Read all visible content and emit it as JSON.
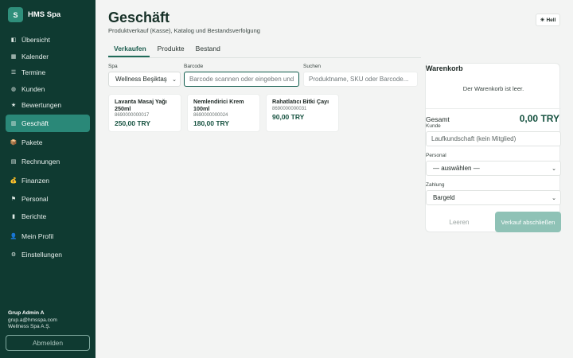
{
  "brand": {
    "logo_letter": "S",
    "name": "HMS Spa"
  },
  "sidebar": {
    "items": [
      {
        "label": "Übersicht",
        "icon": "◧",
        "icon_name": "overview-icon"
      },
      {
        "label": "Kalender",
        "icon": "▦",
        "icon_name": "calendar-icon"
      },
      {
        "label": "Termine",
        "icon": "☰",
        "icon_name": "appointments-icon"
      },
      {
        "label": "Kunden",
        "icon": "◍",
        "icon_name": "customers-icon"
      },
      {
        "label": "Bewertungen",
        "icon": "★",
        "icon_name": "star-icon"
      },
      {
        "label": "Geschäft",
        "icon": "▥",
        "icon_name": "shop-icon"
      },
      {
        "label": "Pakete",
        "icon": "📦",
        "icon_name": "package-icon"
      },
      {
        "label": "Rechnungen",
        "icon": "▤",
        "icon_name": "invoice-icon"
      },
      {
        "label": "Finanzen",
        "icon": "💰",
        "icon_name": "money-bag-icon"
      },
      {
        "label": "Personal",
        "icon": "⚑",
        "icon_name": "staff-icon"
      },
      {
        "label": "Berichte",
        "icon": "▮",
        "icon_name": "reports-icon"
      },
      {
        "label": "Mein Profil",
        "icon": "👤",
        "icon_name": "profile-icon"
      },
      {
        "label": "Einstellungen",
        "icon": "⚙",
        "icon_name": "gear-icon"
      }
    ],
    "active_index": 5
  },
  "user": {
    "name": "Grup Admin A",
    "email": "grup.a@hmsspa.com",
    "company": "Wellness Spa A.Ş.",
    "logout_label": "Abmelden"
  },
  "header": {
    "title": "Geschäft",
    "subtitle": "Produktverkauf (Kasse), Katalog und Bestandsverfolgung",
    "theme_label": "Hell",
    "theme_icon": "☀"
  },
  "tabs": [
    {
      "label": "Verkaufen"
    },
    {
      "label": "Produkte"
    },
    {
      "label": "Bestand"
    }
  ],
  "filters": {
    "spa_label": "Spa",
    "spa_value": "Wellness Beşiktaş",
    "barcode_label": "Barcode",
    "barcode_placeholder": "Barcode scannen oder eingeben und",
    "search_label": "Suchen",
    "search_placeholder": "Produktname, SKU oder Barcode..."
  },
  "products": [
    {
      "name": "Lavanta Masaj Yağı 250ml",
      "sku": "8690000000017",
      "price": "250,00 TRY"
    },
    {
      "name": "Nemlendirici Krem 100ml",
      "sku": "8690000000024",
      "price": "180,00 TRY"
    },
    {
      "name": "Rahatlatıcı Bitki Çayı",
      "sku": "8690000000031",
      "price": "90,00 TRY"
    }
  ],
  "cart": {
    "title": "Warenkorb",
    "empty_text": "Der Warenkorb ist leer.",
    "total_label": "Gesamt",
    "total_value": "0,00 TRY",
    "customer_label": "Kunde",
    "customer_placeholder": "Laufkundschaft (kein Mitglied)",
    "staff_label": "Personal",
    "staff_value": "— auswählen —",
    "payment_label": "Zahlung",
    "payment_value": "Bargeld",
    "clear_label": "Leeren",
    "checkout_label": "Verkauf abschließen"
  }
}
